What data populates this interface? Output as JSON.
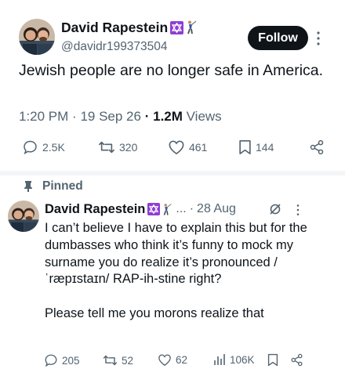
{
  "main_tweet": {
    "author": {
      "display_name": "David Rapestein",
      "handle": "@davidr199373504",
      "badges": [
        "star-of-david-icon",
        "golfer-icon"
      ]
    },
    "follow_label": "Follow",
    "text": "Jewish people are no longer safe in America.",
    "meta": {
      "time": "1:20 PM",
      "sep1": "·",
      "date": "19 Sep 26",
      "sep2": "·",
      "views_count": "1.2M",
      "views_label": "Views"
    },
    "actions": {
      "replies": "2.5K",
      "reposts": "320",
      "likes": "461",
      "bookmarks": "144"
    }
  },
  "pinned_tweet": {
    "pinned_label": "Pinned",
    "author": {
      "display_name": "David Rapestein",
      "ellipsis": "...",
      "sep": "·",
      "date": "28 Aug"
    },
    "text": "I can’t believe I have to explain this but for the dumbasses who think it’s funny to mock my surname you do realize it’s pronounced /ˈræpɪstaɪn/ RAP-ih-stine right?\n\nPlease tell me you morons realize that",
    "actions": {
      "replies": "205",
      "reposts": "52",
      "likes": "62",
      "views": "106K"
    }
  },
  "colors": {
    "primary_text": "#0f1419",
    "secondary_text": "#536471",
    "badge_purple": "#8e3fd3",
    "follow_bg": "#0f1419",
    "divider": "#f3f5f6"
  }
}
